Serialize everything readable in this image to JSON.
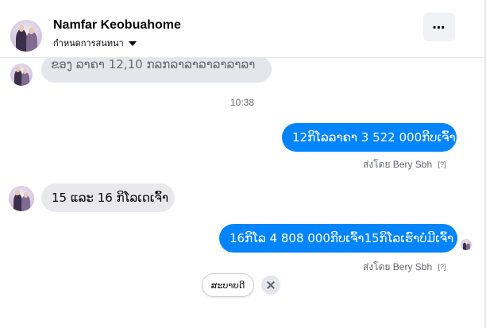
{
  "header": {
    "contact_name": "Namfar Keobuahome",
    "subtitle": "กำหนดการสนทนา",
    "more_label": "⋯"
  },
  "conversation": {
    "partial_message": "ຂອງ ລາຄາ 12,10 ກລກລາລາລາລາລາລາ",
    "timestamp": "10:38",
    "messages": [
      {
        "direction": "outgoing",
        "text": "12ກິໂລລາຄາ 3 522 000ກີບເຈົ້າ",
        "sent_by_prefix": "ส่งโดย",
        "sent_by_name": "Bery Sbh",
        "sent_by_marker": "[?]"
      },
      {
        "direction": "incoming",
        "text": "15  ແລະ 16 ກິໂລເດເຈົ້າ"
      },
      {
        "direction": "outgoing",
        "text": "16ກິໂລ 4 808 000ກີບເຈົ້າ15ກິໂລເຮົາບໍ່ມີເຈົ້າ",
        "sent_by_prefix": "ส่งโดย",
        "sent_by_name": "Bery Sbh",
        "sent_by_marker": "[?]"
      }
    ]
  },
  "quick_reply": {
    "chip_label": "ສະບາຍດີ"
  },
  "colors": {
    "outgoing_bubble": "#0084ff",
    "incoming_bubble": "#e9e9eb",
    "secondary_text": "#65676b"
  },
  "icons": {
    "more": "more-dots-icon",
    "dropdown": "caret-down-icon",
    "dismiss": "close-icon"
  }
}
